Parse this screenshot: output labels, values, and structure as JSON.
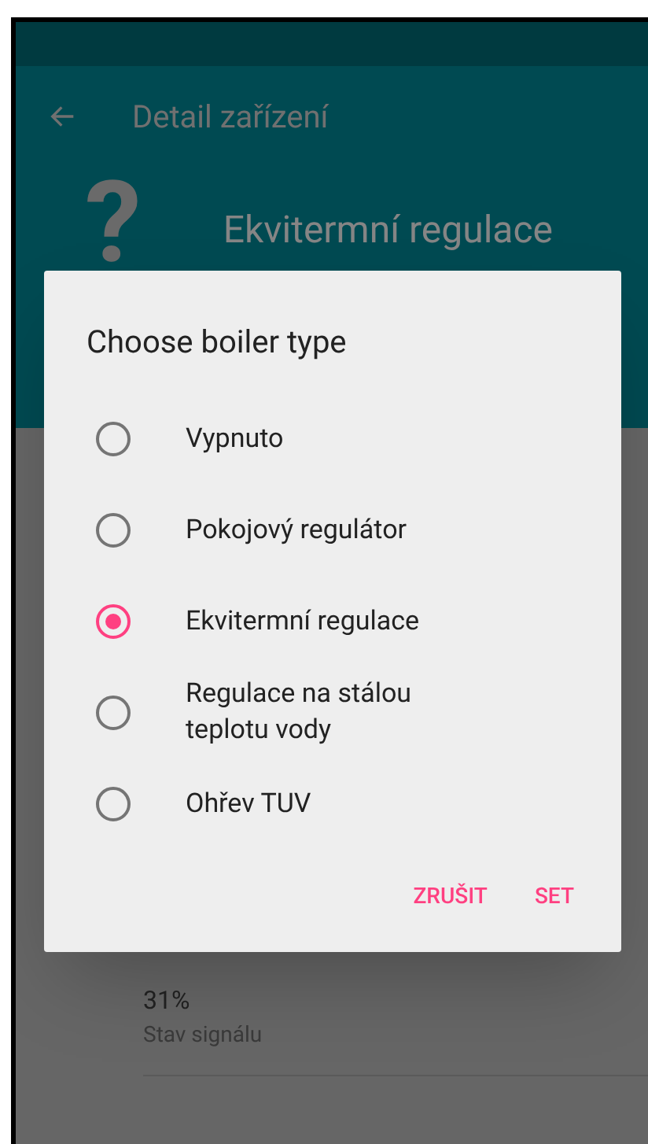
{
  "app_bar": {
    "title": "Detail zařízení"
  },
  "header": {
    "icon": "?",
    "subtitle": "Ekvitermní regulace"
  },
  "list": [
    {
      "value": "31%",
      "label": "Stav signálu"
    }
  ],
  "dialog": {
    "title": "Choose boiler type",
    "options": [
      {
        "label": "Vypnuto",
        "selected": false
      },
      {
        "label": "Pokojový regulátor",
        "selected": false
      },
      {
        "label": "Ekvitermní regulace",
        "selected": true
      },
      {
        "label": "Regulace na stálou teplotu vody",
        "selected": false
      },
      {
        "label": "Ohřev TUV",
        "selected": false
      }
    ],
    "buttons": [
      "ZRUŠIT",
      "SET"
    ]
  }
}
